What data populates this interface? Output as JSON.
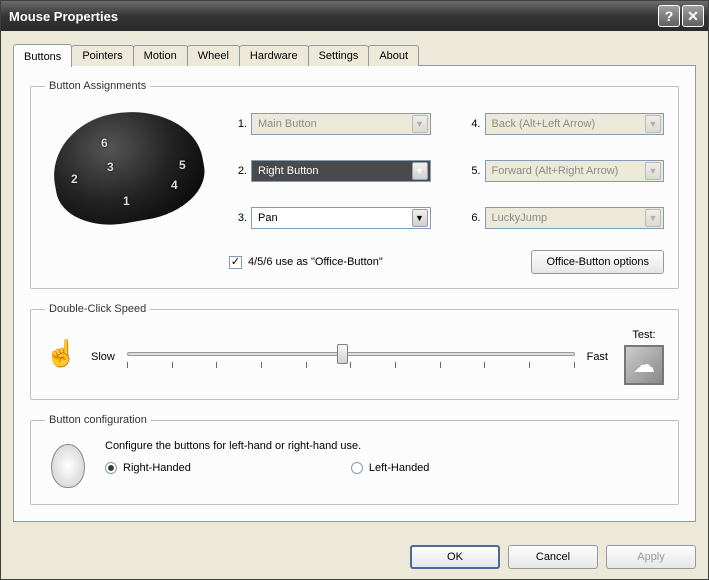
{
  "window": {
    "title": "Mouse Properties"
  },
  "tabs": [
    "Buttons",
    "Pointers",
    "Motion",
    "Wheel",
    "Hardware",
    "Settings",
    "About"
  ],
  "active_tab": 0,
  "assignments": {
    "legend": "Button Assignments",
    "items": [
      {
        "n": "1.",
        "value": "Main Button",
        "disabled": true
      },
      {
        "n": "2.",
        "value": "Right Button",
        "disabled": false,
        "highlight": true
      },
      {
        "n": "3.",
        "value": "Pan",
        "disabled": false
      },
      {
        "n": "4.",
        "value": "Back (Alt+Left Arrow)",
        "disabled": true
      },
      {
        "n": "5.",
        "value": "Forward (Alt+Right Arrow)",
        "disabled": true
      },
      {
        "n": "6.",
        "value": "LuckyJump",
        "disabled": true
      }
    ],
    "checkbox_label": "4/5/6 use as \"Office-Button\"",
    "checkbox_checked": true,
    "options_btn": "Office-Button options"
  },
  "double_click": {
    "legend": "Double-Click Speed",
    "slow": "Slow",
    "fast": "Fast",
    "test_label": "Test:"
  },
  "button_config": {
    "legend": "Button configuration",
    "desc": "Configure the buttons for left-hand or right-hand use.",
    "right": "Right-Handed",
    "left": "Left-Handed",
    "selected": "right"
  },
  "dialog_buttons": {
    "ok": "OK",
    "cancel": "Cancel",
    "apply": "Apply"
  }
}
